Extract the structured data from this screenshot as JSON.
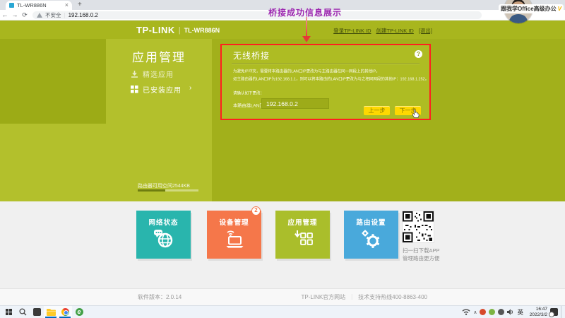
{
  "browser": {
    "tab_title": "TL-WR886N",
    "security_label": "不安全",
    "url": "192.168.0.2",
    "overlay_name": "跟我学Office高级办公",
    "overlay_badge": "V"
  },
  "icons": {
    "back": "←",
    "forward": "→",
    "reload": "⟳",
    "close": "×",
    "new_tab": "+",
    "tray_chevron": "∧"
  },
  "annotation": {
    "text": "桥接成功信息展示"
  },
  "header": {
    "brand": "TP-LINK",
    "separator": "|",
    "model": "TL-WR886N",
    "links": [
      "登录TP-LINK ID",
      "创建TP-LINK ID",
      "[退出]"
    ]
  },
  "sidebar": {
    "title": "应用管理",
    "items": [
      {
        "label": "精选应用"
      },
      {
        "label": "已安装应用",
        "arrow": "›"
      }
    ],
    "storage_text": "路由器可用空间2544KB",
    "storage_percent": 45
  },
  "panel": {
    "title": "无线桥接",
    "help": "?",
    "lines": [
      "为避免IP冲突，需要将本路由器的LAN口IP更改为与主路由器在同一网段上的其他IP。",
      "如主路由器的LAN口IP为192.168.1.1，则可以将本路由的LAN口IP更改为与之相同网段的其他IP：192.168.1.252。"
    ],
    "confirm_line": "请确认如下更改：",
    "lan_label": "本路由器LAN口IP：",
    "lan_value": "192.168.0.2",
    "prev_button": "上一步",
    "next_button": "下一步"
  },
  "tiles": [
    {
      "label": "网络状态",
      "color": "#29b5ad",
      "icon": "globe-chat-icon"
    },
    {
      "label": "设备管理",
      "color": "#f5774a",
      "icon": "laptop-wifi-icon",
      "badge": "2"
    },
    {
      "label": "应用管理",
      "color": "#aabe2b",
      "icon": "apps-grid-icon"
    },
    {
      "label": "路由设置",
      "color": "#49a9db",
      "icon": "gears-icon"
    }
  ],
  "qr": {
    "caption1": "扫一扫下载APP",
    "caption2": "管理路由更方便"
  },
  "footer": {
    "version": "软件版本：2.0.14",
    "site": "TP-LINK官方网站",
    "divider": "｜",
    "hotline": "技术支持热线400-8863-400"
  },
  "taskbar": {
    "ime": "英",
    "time": "16:47",
    "date": "2022/3/2"
  },
  "colors": {
    "page_olive": "#a7b41d",
    "sidebar_olive": "#b3c02c",
    "panel_olive": "#aebc23",
    "annotation_red": "#ff1f1f",
    "button_yellow": "#ffd800"
  }
}
